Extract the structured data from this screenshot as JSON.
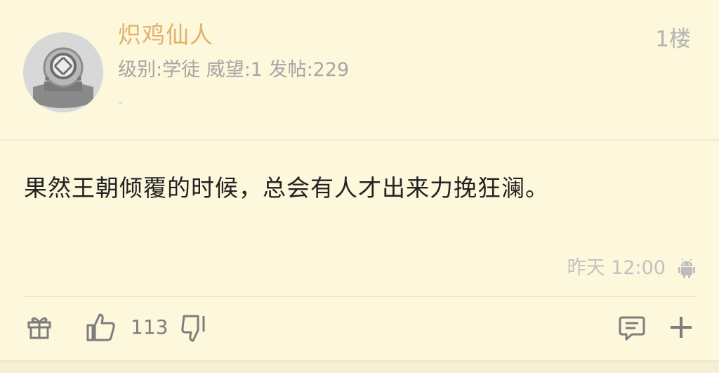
{
  "post": {
    "username": "炽鸡仙人",
    "level_label": "级别:学徒",
    "reputation_label": "威望:1",
    "posts_label": "发帖:229",
    "signature": "-",
    "floor": "1楼",
    "content": "果然王朝倾覆的时候，总会有人才出来力挽狂澜。",
    "time": "昨天 12:00",
    "device_icon": "android-icon",
    "like_count": "113"
  },
  "icons": {
    "avatar": "diving-helmet-avatar",
    "gift": "gift-icon",
    "like": "thumbs-up-icon",
    "dislike": "thumbs-down-icon",
    "comment": "comment-icon",
    "more": "plus-icon"
  },
  "colors": {
    "background": "#fdf7dc",
    "username": "#e0b36b",
    "meta": "#a6a6a6",
    "content": "#222222",
    "icon": "#7d7d7d"
  }
}
